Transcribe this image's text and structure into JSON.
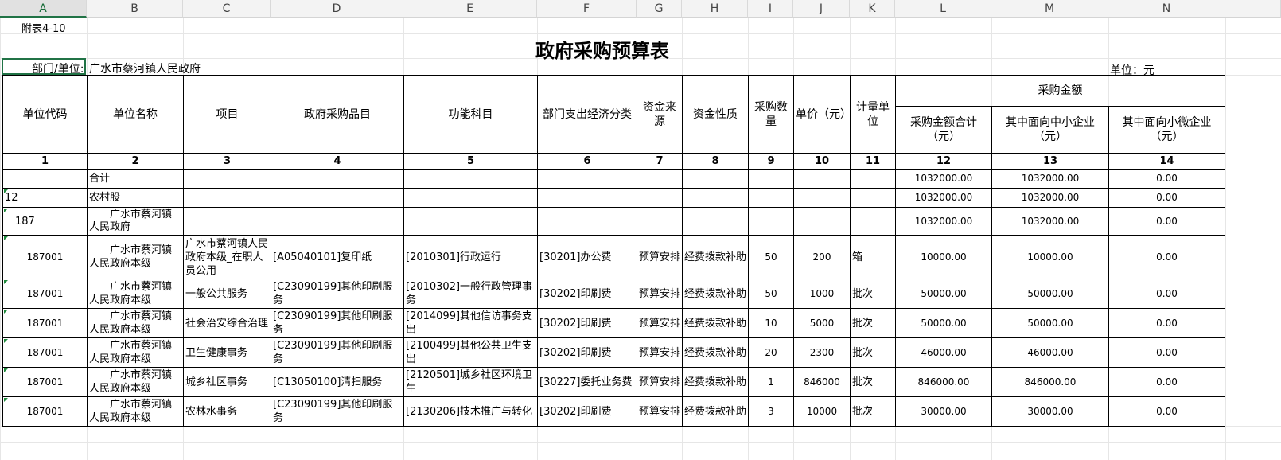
{
  "columns": [
    "A",
    "B",
    "C",
    "D",
    "E",
    "F",
    "G",
    "H",
    "I",
    "J",
    "K",
    "L",
    "M",
    "N"
  ],
  "attachment": "附表4-10",
  "title": "政府采购预算表",
  "dept_label": "部门/单位:",
  "dept_value": "广水市蔡河镇人民政府",
  "unit_label": "单位：元",
  "headers": {
    "unit_code": "单位代码",
    "unit_name": "单位名称",
    "project": "项目",
    "item": "政府采购品目",
    "func": "功能科目",
    "econ": "部门支出经济分类",
    "fund_source": "资金来源",
    "fund_nature": "资金性质",
    "qty": "采购数量",
    "price": "单价（元）",
    "measure": "计量单位",
    "amount_group": "采购金额",
    "amount_total": "采购金额合计（元）",
    "amount_sme": "其中面向中小企业（元）",
    "amount_micro": "其中面向小微企业（元）"
  },
  "index_row": [
    "1",
    "2",
    "3",
    "4",
    "5",
    "6",
    "7",
    "8",
    "9",
    "10",
    "11",
    "12",
    "13",
    "14"
  ],
  "summary_rows": [
    {
      "code": "",
      "name": "合计",
      "total": "1032000.00",
      "sme": "1032000.00",
      "micro": "0.00"
    },
    {
      "code": "12",
      "name": "农村股",
      "total": "1032000.00",
      "sme": "1032000.00",
      "micro": "0.00"
    },
    {
      "code": "187",
      "name": "广水市蔡河镇人民政府",
      "total": "1032000.00",
      "sme": "1032000.00",
      "micro": "0.00"
    }
  ],
  "rows": [
    {
      "code": "187001",
      "name": "广水市蔡河镇人民政府本级",
      "project": "广水市蔡河镇人民政府本级_在职人员公用",
      "item": "[A05040101]复印纸",
      "func": "[2010301]行政运行",
      "econ": "[30201]办公费",
      "source": "预算安排",
      "nature": "经费拨款补助",
      "qty": "50",
      "price": "200",
      "measure": "箱",
      "total": "10000.00",
      "sme": "10000.00",
      "micro": "0.00"
    },
    {
      "code": "187001",
      "name": "广水市蔡河镇人民政府本级",
      "project": "一般公共服务",
      "item": "[C23090199]其他印刷服务",
      "func": "[2010302]一般行政管理事务",
      "econ": "[30202]印刷费",
      "source": "预算安排",
      "nature": "经费拨款补助",
      "qty": "50",
      "price": "1000",
      "measure": "批次",
      "total": "50000.00",
      "sme": "50000.00",
      "micro": "0.00"
    },
    {
      "code": "187001",
      "name": "广水市蔡河镇人民政府本级",
      "project": "社会治安综合治理",
      "item": "[C23090199]其他印刷服务",
      "func": "[2014099]其他信访事务支出",
      "econ": "[30202]印刷费",
      "source": "预算安排",
      "nature": "经费拨款补助",
      "qty": "10",
      "price": "5000",
      "measure": "批次",
      "total": "50000.00",
      "sme": "50000.00",
      "micro": "0.00"
    },
    {
      "code": "187001",
      "name": "广水市蔡河镇人民政府本级",
      "project": "卫生健康事务",
      "item": "[C23090199]其他印刷服务",
      "func": "[2100499]其他公共卫生支出",
      "econ": "[30202]印刷费",
      "source": "预算安排",
      "nature": "经费拨款补助",
      "qty": "20",
      "price": "2300",
      "measure": "批次",
      "total": "46000.00",
      "sme": "46000.00",
      "micro": "0.00"
    },
    {
      "code": "187001",
      "name": "广水市蔡河镇人民政府本级",
      "project": "城乡社区事务",
      "item": "[C13050100]清扫服务",
      "func": "[2120501]城乡社区环境卫生",
      "econ": "[30227]委托业务费",
      "source": "预算安排",
      "nature": "经费拨款补助",
      "qty": "1",
      "price": "846000",
      "measure": "批次",
      "total": "846000.00",
      "sme": "846000.00",
      "micro": "0.00"
    },
    {
      "code": "187001",
      "name": "广水市蔡河镇人民政府本级",
      "project": "农林水事务",
      "item": "[C23090199]其他印刷服务",
      "func": "[2130206]技术推广与转化",
      "econ": "[30202]印刷费",
      "source": "预算安排",
      "nature": "经费拨款补助",
      "qty": "3",
      "price": "10000",
      "measure": "批次",
      "total": "30000.00",
      "sme": "30000.00",
      "micro": "0.00"
    }
  ]
}
